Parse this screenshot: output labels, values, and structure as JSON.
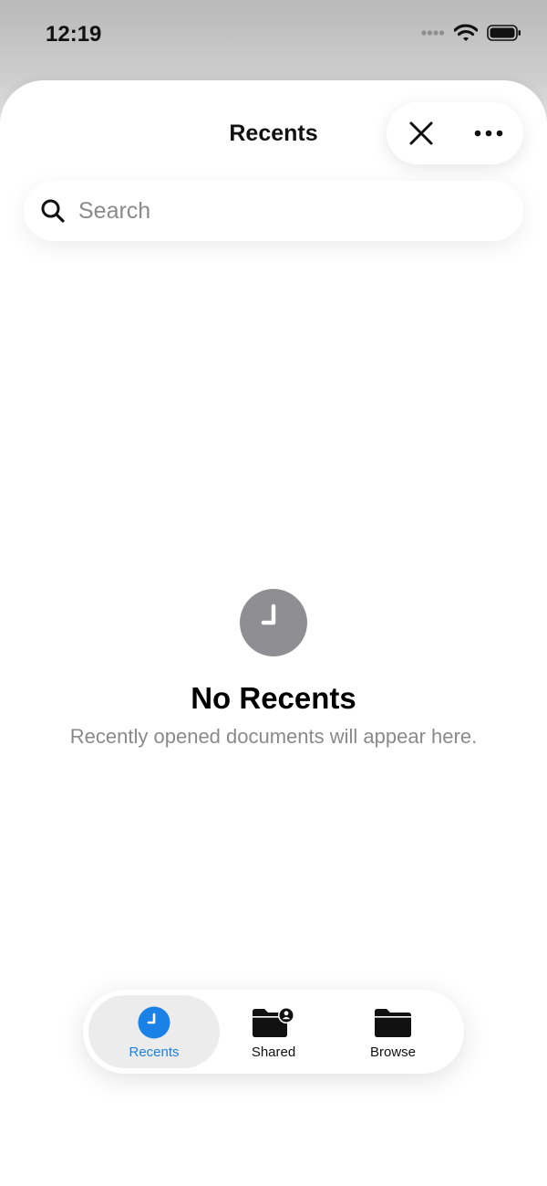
{
  "status_bar": {
    "time": "12:19"
  },
  "header": {
    "title": "Recents",
    "close_icon": "close-icon",
    "more_icon": "ellipsis-icon"
  },
  "search": {
    "placeholder": "Search",
    "value": ""
  },
  "empty_state": {
    "icon": "clock-icon",
    "title": "No Recents",
    "subtitle": "Recently opened documents will appear here."
  },
  "tabs": [
    {
      "label": "Recents",
      "icon": "clock-icon",
      "active": true
    },
    {
      "label": "Shared",
      "icon": "shared-folder-icon",
      "active": false
    },
    {
      "label": "Browse",
      "icon": "folder-icon",
      "active": false
    }
  ],
  "colors": {
    "accent": "#1a82e6",
    "empty_icon": "#8e8e93",
    "secondary_text": "#8a8a8e"
  }
}
